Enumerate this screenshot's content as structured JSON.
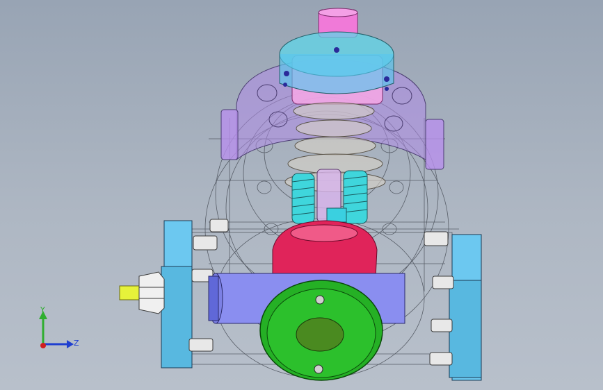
{
  "viewport": {
    "background_top": "#98a4b4",
    "background_bottom": "#b8c0cb"
  },
  "triad": {
    "y_label": "Y",
    "z_label": "Z",
    "y_color": "#2fae2f",
    "z_color": "#1f3fd0",
    "x_color": "#d01f1f"
  },
  "model": {
    "parts": [
      {
        "name": "pink-shaft",
        "color": "#f07ad8"
      },
      {
        "name": "cyan-coupling-flange",
        "color": "#5fd6e8"
      },
      {
        "name": "purple-pump-housing",
        "color": "#b08ce8"
      },
      {
        "name": "cyan-screw-rotors",
        "color": "#3fd6dc"
      },
      {
        "name": "magenta-ball-chamber",
        "color": "#e0245a"
      },
      {
        "name": "blue-horizontal-cylinder",
        "color": "#8a8ef0"
      },
      {
        "name": "green-end-flange",
        "color": "#25b025"
      },
      {
        "name": "light-blue-side-plates",
        "color": "#6cc8f0"
      },
      {
        "name": "yellow-nozzle",
        "color": "#e6f23a"
      }
    ]
  }
}
